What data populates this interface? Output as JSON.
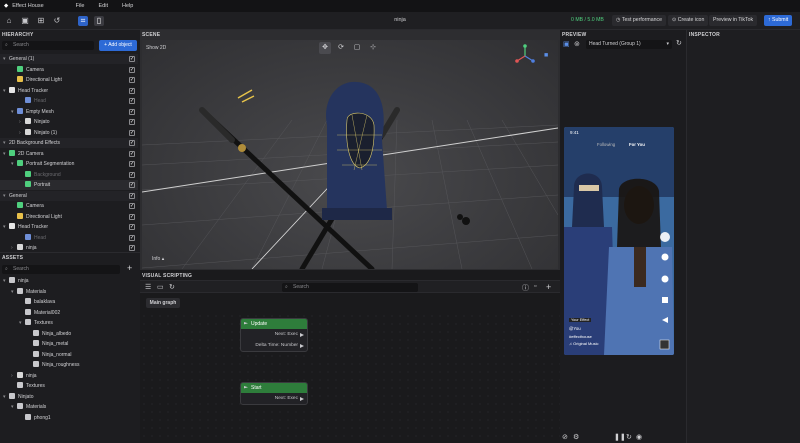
{
  "menubar": {
    "app_name": "Effect House",
    "menus": [
      "File",
      "Edit",
      "Help"
    ]
  },
  "toolbar": {
    "project_name": "ninja",
    "storage": "0 MB / 5.0 MB",
    "test_performance": "Test performance",
    "create_icon": "Create icon",
    "preview_tiktok": "Preview in TikTok",
    "submit": "Submit"
  },
  "hierarchy": {
    "title": "HIERARCHY",
    "search_placeholder": "Search",
    "add_object": "+ Add object",
    "rows": [
      {
        "label": "General (1)",
        "level": 0,
        "type": "group",
        "chev": "▾",
        "check": true
      },
      {
        "label": "Camera",
        "level": 1,
        "icon": "camera",
        "check": true
      },
      {
        "label": "Directional Light",
        "level": 1,
        "icon": "light",
        "check": true
      },
      {
        "label": "Head Tracker",
        "level": 0,
        "icon": "head",
        "chev": "▾",
        "check": true
      },
      {
        "label": "Head",
        "level": 2,
        "icon": "mesh",
        "dim": true,
        "check": true
      },
      {
        "label": "Empty Mesh",
        "level": 1,
        "icon": "mesh",
        "chev": "▾",
        "check": true
      },
      {
        "label": "Ninjato",
        "level": 2,
        "icon": "obj",
        "chev": "›",
        "check": true
      },
      {
        "label": "Ninjato (1)",
        "level": 2,
        "icon": "obj",
        "chev": "›",
        "check": true
      },
      {
        "label": "2D Background Effects",
        "level": 0,
        "type": "group",
        "chev": "▾",
        "check": true
      },
      {
        "label": "2D Camera",
        "level": 0,
        "icon": "camera",
        "chev": "▾",
        "check": true
      },
      {
        "label": "Portrait Segmentation",
        "level": 1,
        "icon": "seg",
        "chev": "▾",
        "check": true
      },
      {
        "label": "Background",
        "level": 2,
        "icon": "img",
        "dim": true,
        "check": true
      },
      {
        "label": "Portrait",
        "level": 2,
        "icon": "img",
        "sel": true,
        "check": true
      },
      {
        "label": "General",
        "level": 0,
        "type": "group",
        "chev": "▾",
        "check": true
      },
      {
        "label": "Camera",
        "level": 1,
        "icon": "camera",
        "check": true
      },
      {
        "label": "Directional Light",
        "level": 1,
        "icon": "light",
        "check": true
      },
      {
        "label": "Head Tracker",
        "level": 0,
        "icon": "head",
        "chev": "▾",
        "check": true
      },
      {
        "label": "Head",
        "level": 2,
        "icon": "mesh",
        "dim": true,
        "check": true
      },
      {
        "label": "ninja",
        "level": 1,
        "icon": "obj",
        "chev": "›",
        "check": true
      }
    ]
  },
  "assets": {
    "title": "ASSETS",
    "search_placeholder": "Search",
    "add": "+",
    "rows": [
      {
        "label": "ninja",
        "level": 0,
        "chev": "▾",
        "icon": "folder"
      },
      {
        "label": "Materials",
        "level": 1,
        "chev": "▾",
        "icon": "folder"
      },
      {
        "label": "balaklava",
        "level": 2,
        "icon": "material"
      },
      {
        "label": "Material002",
        "level": 2,
        "icon": "material"
      },
      {
        "label": "Textures",
        "level": 2,
        "chev": "▾",
        "icon": "folder"
      },
      {
        "label": "Ninja_albedo",
        "level": 3,
        "icon": "image"
      },
      {
        "label": "Ninja_metal",
        "level": 3,
        "icon": "image"
      },
      {
        "label": "Ninja_normal",
        "level": 3,
        "icon": "image"
      },
      {
        "label": "Ninja_roughness",
        "level": 3,
        "icon": "image"
      },
      {
        "label": "ninja",
        "level": 1,
        "chev": "›",
        "icon": "obj"
      },
      {
        "label": "Textures",
        "level": 1,
        "icon": "folder"
      },
      {
        "label": "Ninjato",
        "level": 0,
        "chev": "▾",
        "icon": "folder"
      },
      {
        "label": "Materials",
        "level": 1,
        "chev": "▾",
        "icon": "folder"
      },
      {
        "label": "phong1",
        "level": 2,
        "icon": "material"
      }
    ]
  },
  "scene": {
    "title": "SCENE",
    "show2d": "Show 2D",
    "view_mode": "Info"
  },
  "visual_scripting": {
    "title": "VISUAL SCRIPTING",
    "search_placeholder": "Search",
    "tab": "Main graph",
    "nodes": [
      {
        "title": "Update",
        "outputs": [
          "Next: Exec",
          "Delta Time: Number"
        ]
      },
      {
        "title": "Start",
        "outputs": [
          "Next: Exec"
        ]
      }
    ]
  },
  "preview": {
    "title": "PREVIEW",
    "selection": "Head Turned (Group 1)",
    "phone": {
      "time": "9:41",
      "tabs": [
        "Following",
        "For You"
      ],
      "effect_label": "Your Effect",
      "username": "@You",
      "hashtag": "#effecthouse",
      "music": "♫ Original Music"
    }
  },
  "inspector": {
    "title": "INSPECTOR"
  },
  "colors": {
    "accent": "#2d6ad6",
    "node_header": "#2e7d3b",
    "storage": "#4fcf7e"
  }
}
